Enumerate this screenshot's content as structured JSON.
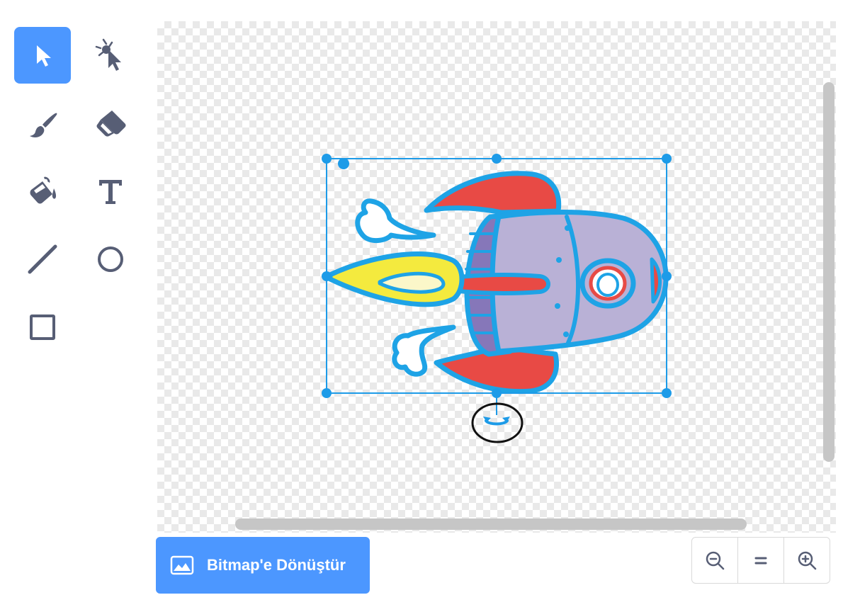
{
  "tools": [
    {
      "id": "select",
      "icon": "arrow-cursor-icon",
      "selected": true
    },
    {
      "id": "reshape",
      "icon": "reshape-cursor-icon",
      "selected": false
    },
    {
      "id": "brush",
      "icon": "brush-icon",
      "selected": false
    },
    {
      "id": "eraser",
      "icon": "eraser-icon",
      "selected": false
    },
    {
      "id": "fill",
      "icon": "paint-bucket-icon",
      "selected": false
    },
    {
      "id": "text",
      "icon": "text-t-icon",
      "glyph": "T",
      "selected": false
    },
    {
      "id": "line",
      "icon": "line-icon",
      "selected": false
    },
    {
      "id": "circle",
      "icon": "circle-icon",
      "selected": false
    },
    {
      "id": "rectangle",
      "icon": "rectangle-icon",
      "selected": false
    }
  ],
  "convert_button": {
    "label": "Bitmap'e Dönüştür",
    "icon": "image-icon"
  },
  "zoom": {
    "out_icon": "zoom-out-icon",
    "reset_icon": "zoom-reset-icon",
    "reset_glyph": "=",
    "in_icon": "zoom-in-icon"
  },
  "colors": {
    "accent": "#4c97ff",
    "tool_icon": "#575e75",
    "selection": "#1d9be8",
    "rocket_outline": "#1ea3e6",
    "rocket_red": "#e84a45",
    "rocket_body": "#b9b1d6",
    "rocket_yellow": "#f4ea3e"
  }
}
